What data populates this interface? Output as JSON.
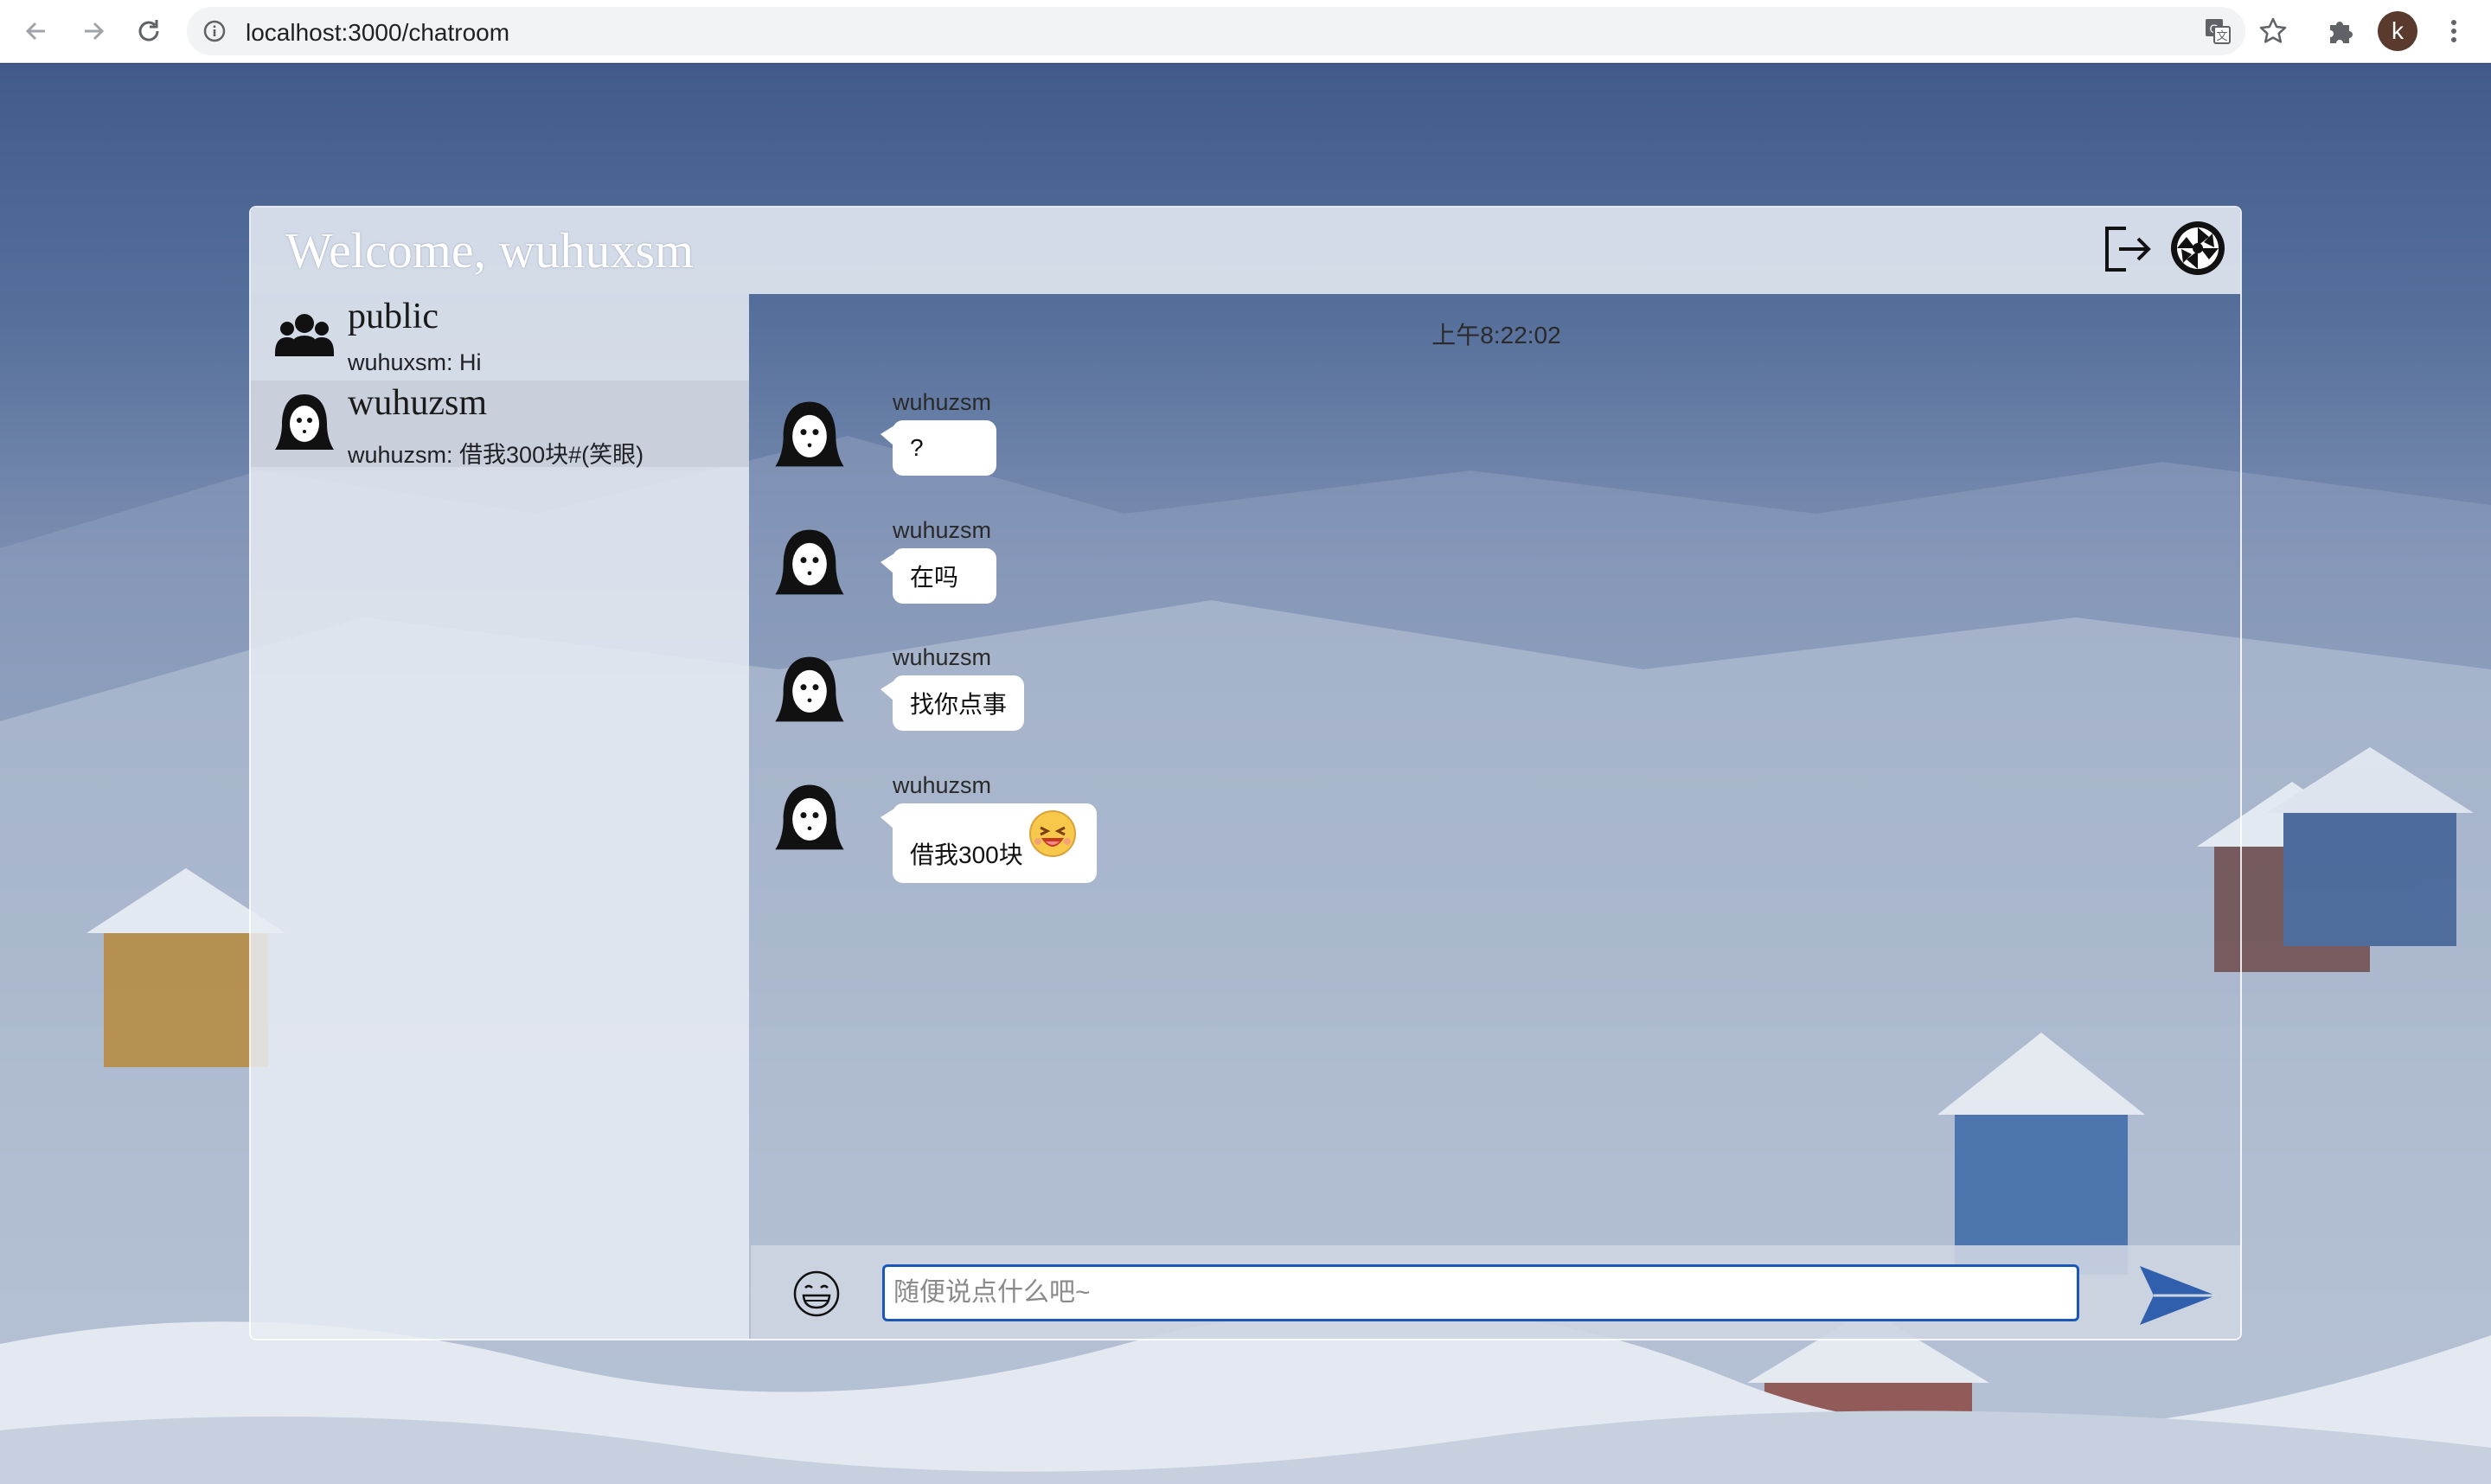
{
  "browser": {
    "url": "localhost:3000/chatroom",
    "profile_initial": "k"
  },
  "header": {
    "title": "Welcome, wuhuxsm"
  },
  "conversations": [
    {
      "name": "public",
      "preview": "wuhuxsm: Hi",
      "icon": "group-icon",
      "active": false
    },
    {
      "name": "wuhuzsm",
      "preview": "wuhuzsm: 借我300块#(笑眼)",
      "icon": "ghost-avatar-icon",
      "active": true
    }
  ],
  "chat": {
    "timestamp": "上午8:22:02",
    "messages": [
      {
        "sender": "wuhuzsm",
        "text": "?"
      },
      {
        "sender": "wuhuzsm",
        "text": "在吗"
      },
      {
        "sender": "wuhuzsm",
        "text": "找你点事"
      },
      {
        "sender": "wuhuzsm",
        "text": "借我300块",
        "emoji": "laughing-emoji-icon"
      }
    ]
  },
  "input": {
    "placeholder": "随便说点什么吧~"
  },
  "colors": {
    "input_border": "#1a57b8",
    "send_arrow": "#2f5fad",
    "active_conversation": "#c8cfdb"
  }
}
